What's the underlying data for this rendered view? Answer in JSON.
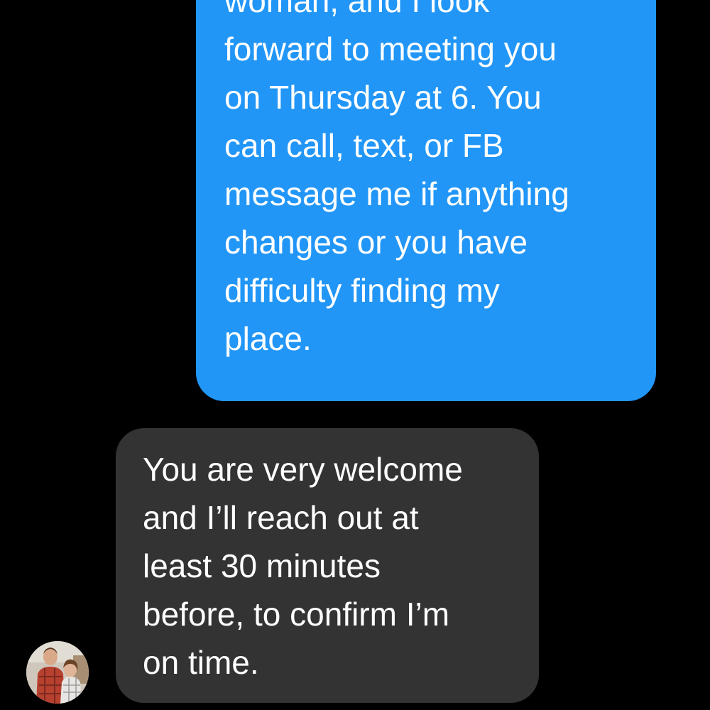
{
  "conversation": {
    "outgoing_message": {
      "lines": [
        "woman, and I look",
        "forward to meeting you",
        "on Thursday at 6. You",
        "can call, text, or FB",
        "message me if anything",
        "changes or you have",
        "difficulty finding my",
        "place."
      ]
    },
    "incoming_message": {
      "lines": [
        "You are very welcome",
        "and I’ll reach out at",
        "least 30 minutes",
        "before, to confirm I’m",
        "on time."
      ]
    },
    "contact": {
      "avatar_icon": "profile-photo-avatar"
    }
  },
  "colors": {
    "background": "#000000",
    "outgoing_bubble": "#2196f7",
    "incoming_bubble": "#333333",
    "text": "#ffffff"
  }
}
